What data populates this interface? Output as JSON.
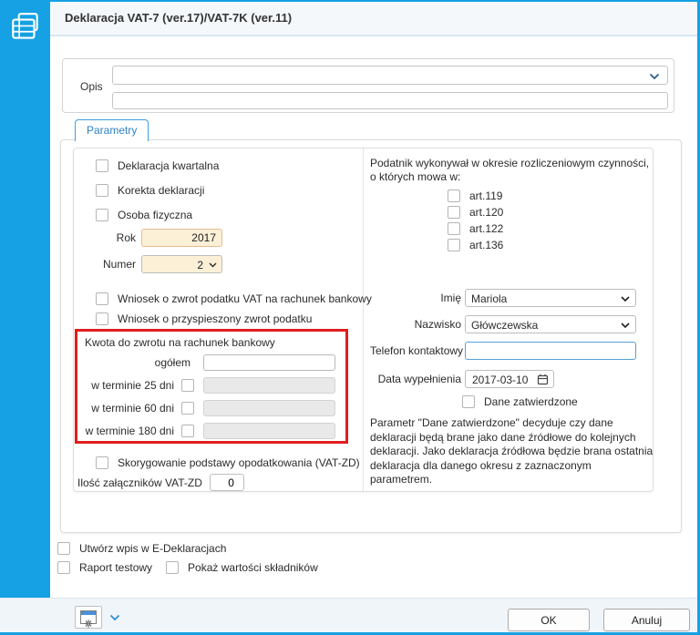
{
  "window": {
    "title": "Deklaracja VAT-7 (ver.17)/VAT-7K (ver.11)"
  },
  "colors": {
    "accent_blue": "#15a1e3",
    "tab_blue": "#2e82c6",
    "highlight_red": "#e01f1f",
    "field_cream": "#fcf0d6",
    "focus_blue": "#57a0d9"
  },
  "icons": {
    "app": "document-table-icon",
    "combo": "chevron-down-icon",
    "date": "calendar-icon",
    "settings": "settings-window-icon"
  },
  "opis": {
    "label": "Opis",
    "combo_value": "",
    "input_value": ""
  },
  "tabs": [
    {
      "label": "Parametry",
      "active": true
    }
  ],
  "left": {
    "checkboxes": [
      {
        "label": "Deklaracja kwartalna",
        "checked": false
      },
      {
        "label": "Korekta deklaracji",
        "checked": false
      },
      {
        "label": "Osoba fizyczna",
        "checked": false
      }
    ],
    "rok": {
      "label": "Rok",
      "value": "2017"
    },
    "numer": {
      "label": "Numer",
      "value": "2"
    },
    "wnioski": [
      {
        "label": "Wniosek o zwrot podatku VAT na rachunek bankowy",
        "checked": false
      },
      {
        "label": "Wniosek o przyspieszony zwrot podatku",
        "checked": false
      }
    ],
    "kwota_box": {
      "title": "Kwota do zwrotu na rachunek bankowy",
      "ogolem_label": "ogółem",
      "ogolem_value": "",
      "rows": [
        {
          "label": "w terminie 25 dni",
          "checked": false,
          "value": "",
          "disabled": true
        },
        {
          "label": "w terminie 60 dni",
          "checked": false,
          "value": "",
          "disabled": true
        },
        {
          "label": "w terminie 180 dni",
          "checked": false,
          "value": "",
          "disabled": true
        }
      ]
    },
    "skorygowanie": {
      "label": "Skorygowanie podstawy opodatkowania (VAT-ZD)",
      "checked": false
    },
    "zalaczniki": {
      "label": "Ilość załączników VAT-ZD",
      "value": "0"
    }
  },
  "right": {
    "podatnik_text": "Podatnik wykonywał w okresie rozliczeniowym czynności, o których mowa w:",
    "articles": [
      {
        "label": "art.119",
        "checked": false
      },
      {
        "label": "art.120",
        "checked": false
      },
      {
        "label": "art.122",
        "checked": false
      },
      {
        "label": "art.136",
        "checked": false
      }
    ],
    "imie": {
      "label": "Imię",
      "value": "Mariola"
    },
    "nazwisko": {
      "label": "Nazwisko",
      "value": "Główczewska"
    },
    "telefon": {
      "label": "Telefon kontaktowy",
      "value": ""
    },
    "data": {
      "label": "Data wypełnienia",
      "value": "2017-03-10"
    },
    "dane_zatwierdzone": {
      "label": "Dane zatwierdzone",
      "checked": false
    },
    "note": "Parametr \"Dane zatwierdzone\" decyduje czy dane deklaracji będą brane jako dane źródłowe do kolejnych deklaracji. Jako deklaracja źródłowa będzie brana ostatnia deklaracja dla danego okresu z zaznaczonym parametrem."
  },
  "bottom": {
    "utworz": {
      "label": "Utwórz wpis w E-Deklaracjach",
      "checked": false
    },
    "raport": {
      "label": "Raport testowy",
      "checked": false
    },
    "pokaz": {
      "label": "Pokaż wartości składników",
      "checked": false
    }
  },
  "footer": {
    "ok_label": "OK",
    "cancel_label": "Anuluj"
  }
}
